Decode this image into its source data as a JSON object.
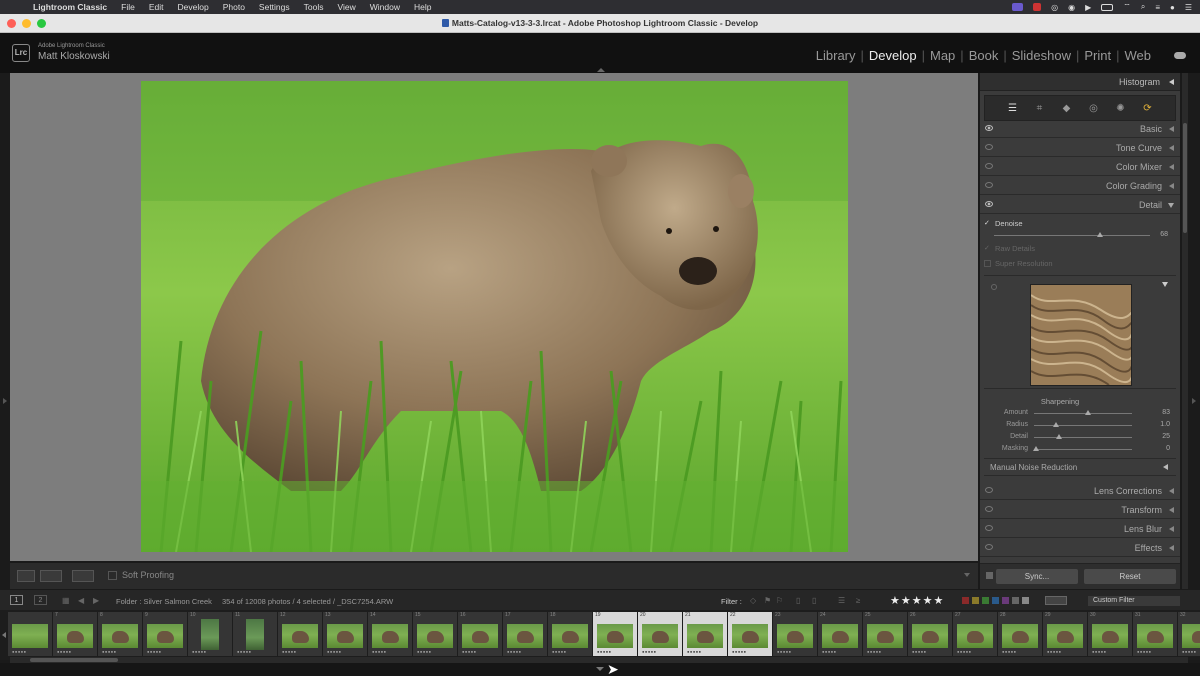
{
  "menubar": {
    "app_name": "Lightroom Classic",
    "items": [
      "File",
      "Edit",
      "Develop",
      "Photo",
      "Settings",
      "Tools",
      "View",
      "Window",
      "Help"
    ]
  },
  "window": {
    "title": "Matts-Catalog-v13-3-3.lrcat - Adobe Photoshop Lightroom Classic - Develop"
  },
  "identity": {
    "product": "Adobe Lightroom Classic",
    "user": "Matt Kloskowski",
    "badge": "Lrc"
  },
  "modules": [
    {
      "label": "Library",
      "active": false
    },
    {
      "label": "Develop",
      "active": true
    },
    {
      "label": "Map",
      "active": false
    },
    {
      "label": "Book",
      "active": false
    },
    {
      "label": "Slideshow",
      "active": false
    },
    {
      "label": "Print",
      "active": false
    },
    {
      "label": "Web",
      "active": false
    }
  ],
  "toolbar": {
    "soft_proofing": "Soft Proofing"
  },
  "right_panel": {
    "histogram": "Histogram",
    "tools": [
      "sliders-icon",
      "crop-icon",
      "heal-icon",
      "redeye-icon",
      "masking-icon",
      "presets-icon"
    ],
    "sections_top": [
      "Basic",
      "Tone Curve",
      "Color Mixer",
      "Color Grading",
      "Detail"
    ],
    "detail": {
      "denoise_label": "Denoise",
      "denoise_value": "68",
      "denoise_amount": 0.68,
      "raw_details": "Raw Details",
      "super_resolution": "Super Resolution",
      "sharpening_title": "Sharpening",
      "sharpening": [
        {
          "label": "Amount",
          "value": "83",
          "frac": 0.55
        },
        {
          "label": "Radius",
          "value": "1.0",
          "frac": 0.22
        },
        {
          "label": "Detail",
          "value": "25",
          "frac": 0.26
        },
        {
          "label": "Masking",
          "value": "0",
          "frac": 0.02
        }
      ],
      "manual_noise": "Manual Noise Reduction"
    },
    "sections_bottom": [
      "Lens Corrections",
      "Transform",
      "Lens Blur",
      "Effects"
    ],
    "sync_label": "Sync...",
    "reset_label": "Reset"
  },
  "filmstrip_bar": {
    "page1": "1",
    "page2": "2",
    "source": "Folder : Silver Salmon Creek",
    "count": "354 of 12008 photos / 4 selected / _DSC7254.ARW",
    "filter_label": "Filter :",
    "stars": "★★★★★",
    "custom_filter": "Custom Filter",
    "label_colors": [
      "#8b2a2a",
      "#8b7a2a",
      "#3a7a33",
      "#2a5a8b",
      "#6a3a7a",
      "#666666",
      "#888888"
    ]
  },
  "filmstrip": {
    "cells": [
      {
        "idx": "",
        "tall": false,
        "bear": false,
        "state": ""
      },
      {
        "idx": "7",
        "tall": false,
        "bear": true,
        "state": ""
      },
      {
        "idx": "8",
        "tall": false,
        "bear": true,
        "state": ""
      },
      {
        "idx": "9",
        "tall": false,
        "bear": true,
        "state": ""
      },
      {
        "idx": "10",
        "tall": true,
        "bear": false,
        "state": ""
      },
      {
        "idx": "11",
        "tall": true,
        "bear": false,
        "state": ""
      },
      {
        "idx": "12",
        "tall": false,
        "bear": true,
        "state": ""
      },
      {
        "idx": "13",
        "tall": false,
        "bear": true,
        "state": ""
      },
      {
        "idx": "14",
        "tall": false,
        "bear": true,
        "state": ""
      },
      {
        "idx": "15",
        "tall": false,
        "bear": true,
        "state": ""
      },
      {
        "idx": "16",
        "tall": false,
        "bear": true,
        "state": ""
      },
      {
        "idx": "17",
        "tall": false,
        "bear": true,
        "state": ""
      },
      {
        "idx": "18",
        "tall": false,
        "bear": true,
        "state": ""
      },
      {
        "idx": "19",
        "tall": false,
        "bear": true,
        "state": "sel"
      },
      {
        "idx": "20",
        "tall": false,
        "bear": true,
        "state": "sel"
      },
      {
        "idx": "21",
        "tall": false,
        "bear": true,
        "state": "sel"
      },
      {
        "idx": "22",
        "tall": false,
        "bear": true,
        "state": "sel"
      },
      {
        "idx": "23",
        "tall": false,
        "bear": true,
        "state": ""
      },
      {
        "idx": "24",
        "tall": false,
        "bear": true,
        "state": ""
      },
      {
        "idx": "25",
        "tall": false,
        "bear": true,
        "state": ""
      },
      {
        "idx": "26",
        "tall": false,
        "bear": true,
        "state": ""
      },
      {
        "idx": "27",
        "tall": false,
        "bear": true,
        "state": ""
      },
      {
        "idx": "28",
        "tall": false,
        "bear": true,
        "state": ""
      },
      {
        "idx": "29",
        "tall": false,
        "bear": true,
        "state": ""
      },
      {
        "idx": "30",
        "tall": false,
        "bear": true,
        "state": ""
      },
      {
        "idx": "31",
        "tall": false,
        "bear": true,
        "state": ""
      },
      {
        "idx": "32",
        "tall": false,
        "bear": true,
        "state": ""
      }
    ]
  }
}
